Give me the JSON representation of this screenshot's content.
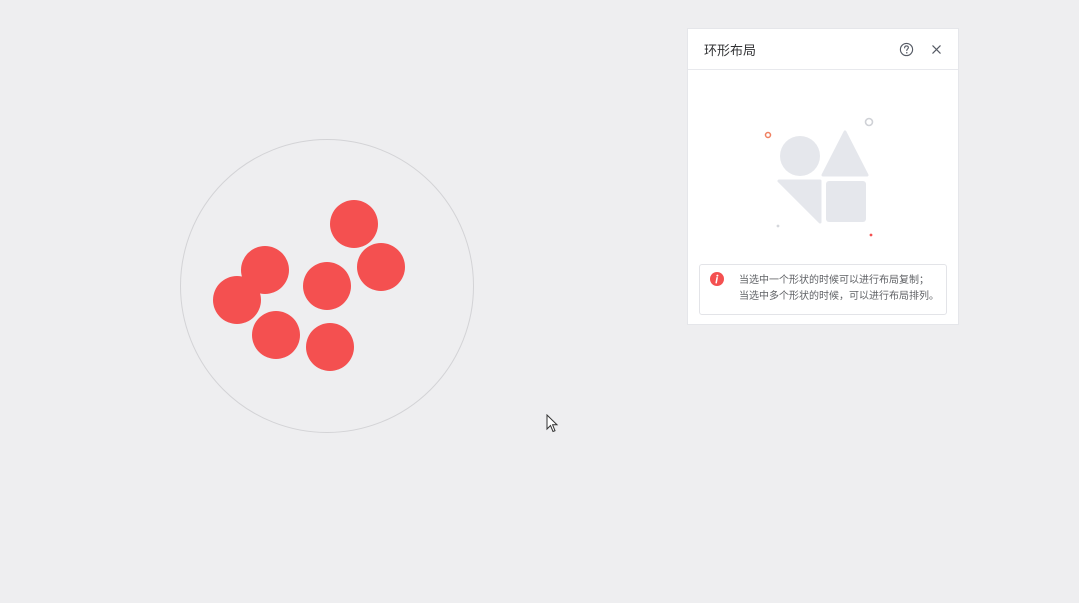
{
  "canvas": {
    "shape_color": "#f45050",
    "ring_color": "#d3d3d6",
    "background": "#eeeef0"
  },
  "panel": {
    "title": "环形布局",
    "help_icon": "question-circle-icon",
    "close_icon": "close-icon",
    "illustration_icon": "shapes-illustration-icon",
    "notice": {
      "icon": "info-circle-icon",
      "icon_color": "#f45050",
      "line1": "当选中一个形状的时候可以进行布局复制；",
      "line2": "当选中多个形状的时候，可以进行布局排列。"
    }
  }
}
